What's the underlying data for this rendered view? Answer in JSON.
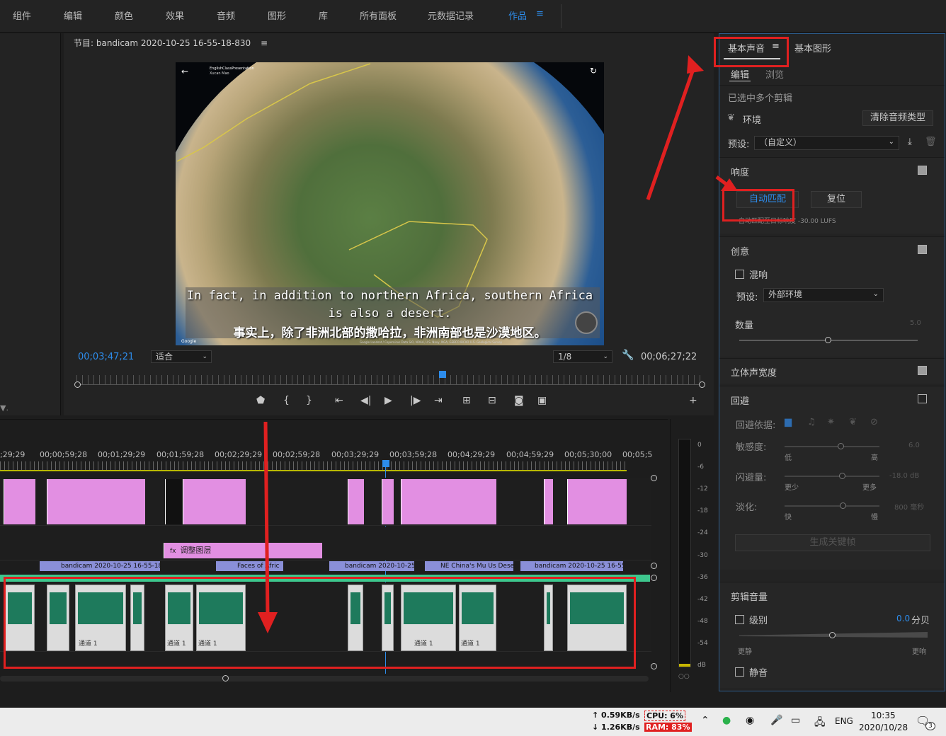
{
  "workspaces": [
    "组件",
    "编辑",
    "颜色",
    "效果",
    "音频",
    "图形",
    "库",
    "所有面板",
    "元数据记录",
    "作品"
  ],
  "active_workspace": "作品",
  "workspace_menu_icon": "≡",
  "monitor": {
    "title": "节目: bandicam 2020-10-25 16-55-18-830",
    "menu_icon": "≡",
    "video_header_1": "EnglishClassPresentation",
    "video_header_2": "Xucan Mao",
    "subtitle_en_1": "In fact, in addition to northern Africa, southern Africa",
    "subtitle_en_2": "is also a desert.",
    "subtitle_zh": "事实上，除了非洲北部的撒哈拉，非洲南部也是沙漠地区。",
    "google_label": "Google",
    "imagery_credit": "Google  Landsat / Copernicus  Data SIO, NOAA, U.S. Navy, NGA, GEBCO  IBCAO  U.S. Geological Survey",
    "timecode_current": "00;03;47;21",
    "fit_label": "适合",
    "resolution_label": "1/8",
    "timecode_duration": "00;06;27;22"
  },
  "timeline": {
    "timecodes": [
      ";29;29",
      "00;00;59;28",
      "00;01;29;29",
      "00;01;59;28",
      "00;02;29;29",
      "00;02;59;28",
      "00;03;29;29",
      "00;03;59;28",
      "00;04;29;29",
      "00;04;59;29",
      "00;05;30;00",
      "00;05;5"
    ],
    "adjustment_layer_label": "调整图层",
    "video_bar_labels": [
      "bandicam 2020-10-25 16-55-18-83",
      "Faces of Afric",
      "bandicam 2020-10-25 1",
      "NE China's Mu Us Dese",
      "bandicam 2020-10-25 16-55-1"
    ],
    "audio_clip_label": "通道 1",
    "fx_label": "fx"
  },
  "meter": {
    "db_marks": [
      "0",
      "-6",
      "-12",
      "-18",
      "-24",
      "-30",
      "-36",
      "-42",
      "-48",
      "-54",
      "dB"
    ],
    "footer": "○○"
  },
  "right_panel": {
    "tab_essential_sound": "基本声音",
    "tab_menu_icon": "≡",
    "tab_essential_graphics": "基本图形",
    "subtab_edit": "编辑",
    "subtab_browse": "浏览",
    "selection_info": "已选中多个剪辑",
    "clip_type": "环境",
    "clear_type_button": "清除音频类型",
    "preset_label": "预设:",
    "preset_value": "（自定义）",
    "loudness_header": "响度",
    "auto_match_button": "自动匹配",
    "reset_button": "复位",
    "auto_match_info": "自动匹配至目标响度 -30.00 LUFS",
    "creative_header": "创意",
    "reverb_label": "混响",
    "creative_preset_label": "预设:",
    "creative_preset_value": "外部环境",
    "amount_label": "数量",
    "amount_value": "5.0",
    "stereo_width_header": "立体声宽度",
    "ducking_header": "回避",
    "duck_against_label": "回避依据:",
    "sensitivity_label": "敏感度:",
    "sensitivity_value": "6.0",
    "sensitivity_low": "低",
    "sensitivity_high": "高",
    "duck_amount_label": "闪避量:",
    "duck_amount_value": "-18.0 dB",
    "duck_amount_less": "更少",
    "duck_amount_more": "更多",
    "fade_label": "淡化:",
    "fade_value": "800 毫秒",
    "fade_fast": "快",
    "fade_slow": "慢",
    "generate_keyframes_button": "生成关键帧",
    "clip_volume_header": "剪辑音量",
    "level_label": "级别",
    "level_value": "0.0",
    "level_unit": "分贝",
    "level_quieter": "更静",
    "level_louder": "更响",
    "mute_label": "静音"
  },
  "taskbar": {
    "net_up": "↑ 0.59KB/s",
    "net_down": "↓ 1.26KB/s",
    "cpu": "CPU:  6%",
    "ram": "RAM: 83%",
    "lang": "ENG",
    "time": "10:35",
    "date": "2020/10/28",
    "notifications": "3"
  }
}
